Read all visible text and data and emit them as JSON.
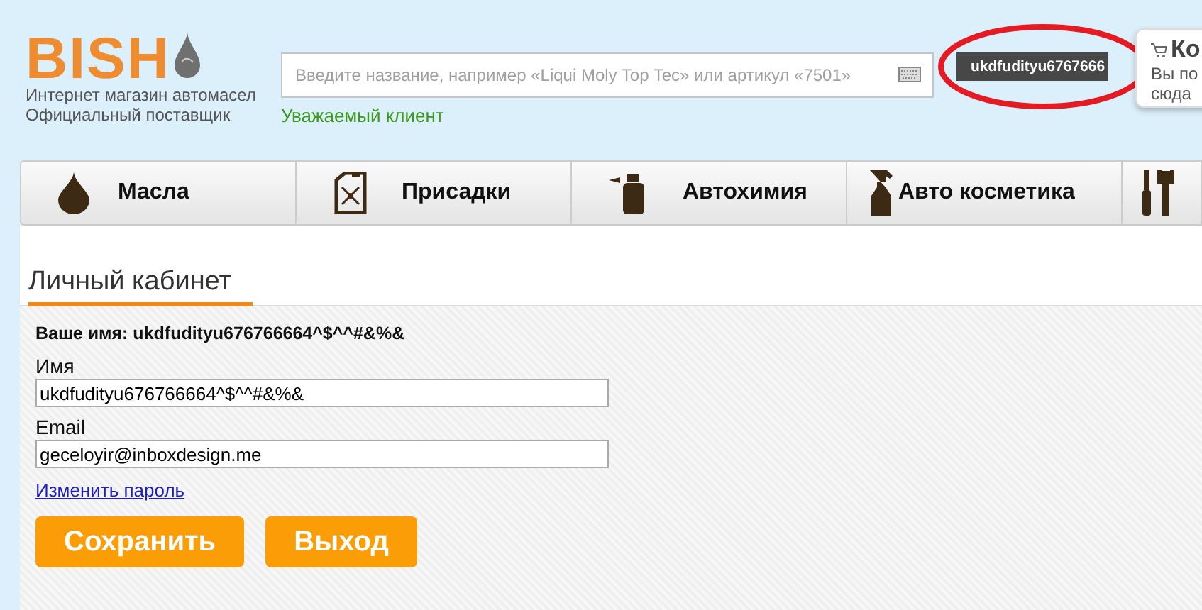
{
  "logo": {
    "brand": "BISH",
    "tagline": [
      "Интернет магазин автомасел",
      "Официальный поставщик"
    ]
  },
  "search": {
    "placeholder": "Введите название, например «Liqui Moly Top Tec» или артикул «7501»"
  },
  "greeting": "Уважаемый клиент",
  "user_chip": "ukdfudityu6767666",
  "cart_popup": {
    "title": "Ко",
    "lines": [
      "Вы по",
      "сюда"
    ]
  },
  "nav": [
    {
      "label": "Масла"
    },
    {
      "label": "Присадки"
    },
    {
      "label": "Автохимия"
    },
    {
      "label": "Авто косметика"
    }
  ],
  "page_title": "Личный кабинет",
  "your_name": "Ваше имя: ukdfudityu676766664^$^^#&%&",
  "fields": [
    {
      "label": "Имя",
      "value": "ukdfudityu676766664^$^^#&%&"
    },
    {
      "label": "Email",
      "value": "geceloyir@inboxdesign.me"
    }
  ],
  "change_password": "Изменить пароль",
  "buttons": [
    "Сохранить",
    "Выход"
  ]
}
